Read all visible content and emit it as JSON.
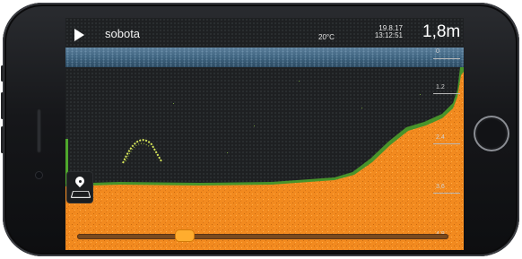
{
  "app": {
    "title": "sobota",
    "temperature": "20°C",
    "date": "19.8.17",
    "time": "13:12:51",
    "depth": "1,8m"
  },
  "depth_scale": {
    "labels": [
      "0",
      "1.2",
      "2.4",
      "3.6",
      "4.8"
    ]
  },
  "icons": {
    "play": "play-icon",
    "map": "map-pin-icon"
  },
  "colors": {
    "bottom": "#f28a1f",
    "vegetation": "#4fa82c",
    "surface": "#46708f",
    "background": "#1e2022",
    "thumb": "#ffad2e"
  },
  "timeline": {
    "position": 0.29
  }
}
